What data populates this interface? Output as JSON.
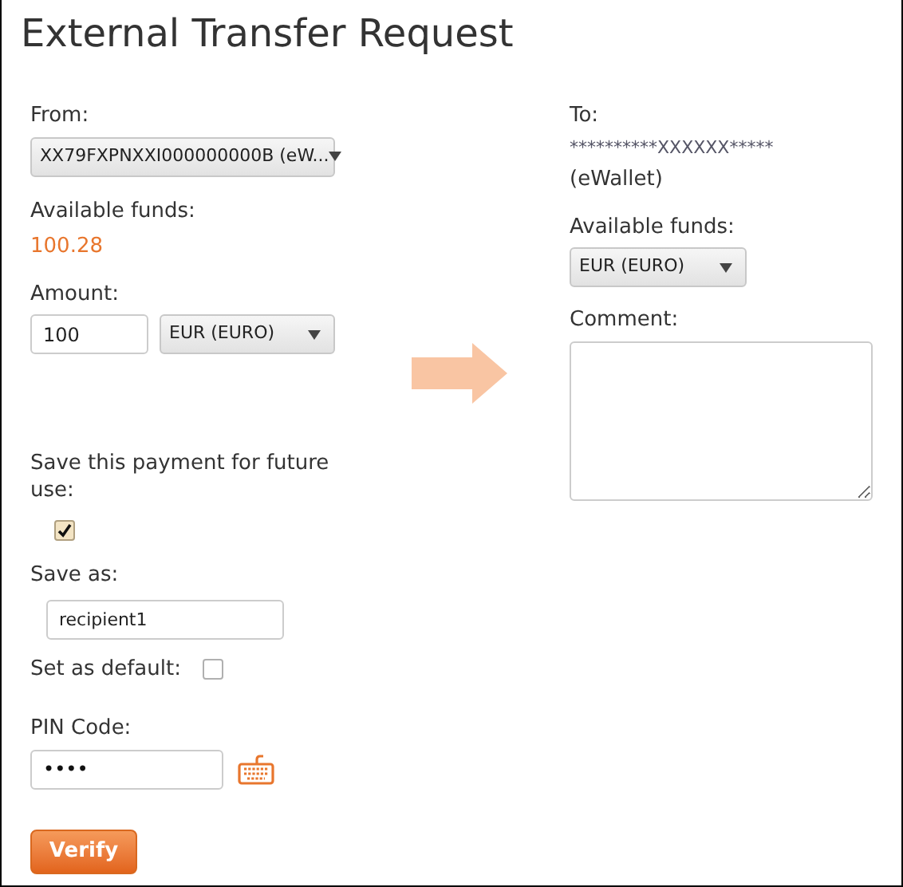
{
  "title": "External Transfer Request",
  "from": {
    "label": "From:",
    "value": "XX79FXPNXXI000000000B (eW..."
  },
  "available": {
    "label": "Available funds:",
    "amount": "100.28"
  },
  "amount": {
    "label": "Amount:",
    "value": "100",
    "currency": "EUR (EURO)"
  },
  "save_payment": {
    "label": "Save this payment for future use:",
    "checked": true
  },
  "save_as": {
    "label": "Save as:",
    "value": "recipient1"
  },
  "set_default": {
    "label": "Set as default:",
    "checked": false
  },
  "pin": {
    "label": "PIN Code:",
    "value": "••••"
  },
  "verify_button": "Verify",
  "to": {
    "label": "To:",
    "masked": "**********XXXXXX*****",
    "type": "(eWallet)"
  },
  "to_available": {
    "label": "Available funds:",
    "currency": "EUR (EURO)"
  },
  "comment": {
    "label": "Comment:"
  }
}
